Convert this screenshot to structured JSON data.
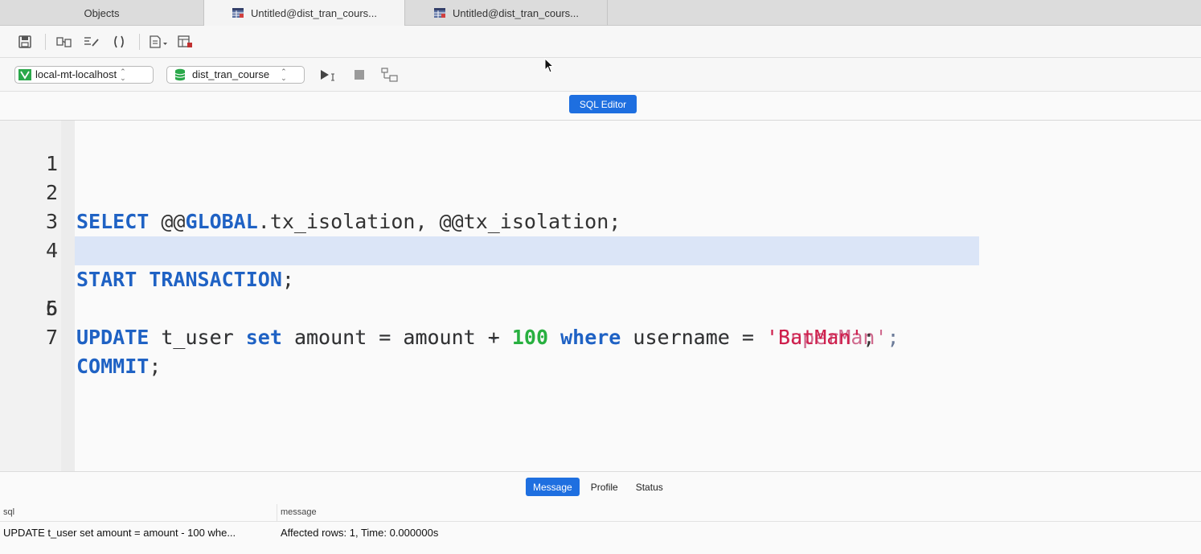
{
  "tabs": {
    "objects": "Objects",
    "query1": "Untitled@dist_tran_cours...",
    "query2": "Untitled@dist_tran_cours..."
  },
  "toolbar": {
    "icons": [
      "save-icon",
      "format-icon",
      "beautify-icon",
      "parentheses-icon",
      "snippet-icon",
      "explain-icon"
    ]
  },
  "connection": {
    "server": "local-mt-localhost",
    "database": "dist_tran_course"
  },
  "editor_title": "SQL Editor",
  "editor": {
    "line_numbers": [
      "1",
      "2",
      "3",
      "4",
      "5",
      "6",
      "7"
    ],
    "highlighted_line": 5
  },
  "bottom": {
    "tabs": [
      "Message",
      "Profile",
      "Status"
    ],
    "active_tab": "Message",
    "columns": [
      "sql",
      "message"
    ],
    "row": {
      "sql": "UPDATE t_user set amount = amount - 100 whe...",
      "message": "Affected rows: 1, Time: 0.000000s"
    }
  },
  "colors": {
    "accent": "#1e6fe0",
    "keyword": "#1f62c4",
    "number": "#28b040",
    "string": "#cf1f4c",
    "selection": "#dbe5f7"
  }
}
